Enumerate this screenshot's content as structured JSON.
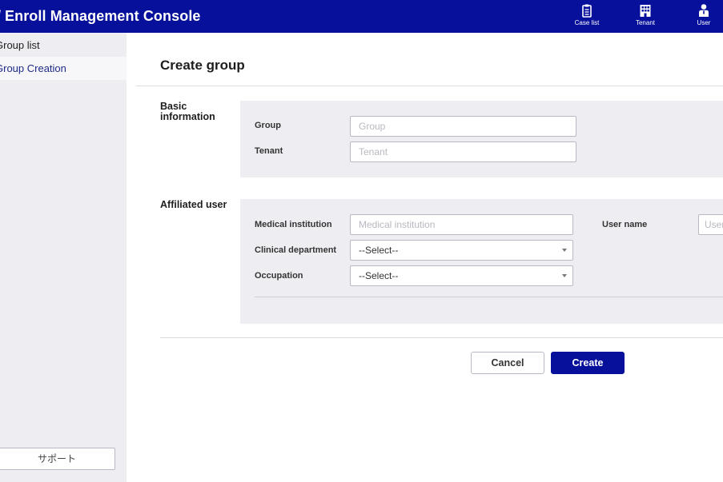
{
  "header": {
    "app_title": "Enroll Management Console",
    "nav": [
      {
        "label": "Case list",
        "icon": "clipboard-icon"
      },
      {
        "label": "Tenant",
        "icon": "building-icon"
      },
      {
        "label": "User",
        "icon": "user-icon"
      }
    ],
    "bg_color": "#06109a"
  },
  "sidebar": {
    "items": [
      {
        "label": "Group list",
        "active": false
      },
      {
        "label": "Group Creation",
        "active": true
      }
    ],
    "support_label": "サポート"
  },
  "main": {
    "title": "Create group",
    "basic": {
      "label": "Basic information",
      "group_label": "Group",
      "group_placeholder": "Group",
      "tenant_label": "Tenant",
      "tenant_placeholder": "Tenant"
    },
    "affiliated": {
      "label": "Affiliated user",
      "medical_label": "Medical institution",
      "medical_placeholder": "Medical institution",
      "username_label": "User name",
      "username_placeholder": "User name",
      "clinical_label": "Clinical department",
      "clinical_value": "--Select--",
      "occupation_label": "Occupation",
      "occupation_value": "--Select--"
    },
    "cancel_label": "Cancel",
    "create_label": "Create",
    "accent_color": "#06109a"
  }
}
